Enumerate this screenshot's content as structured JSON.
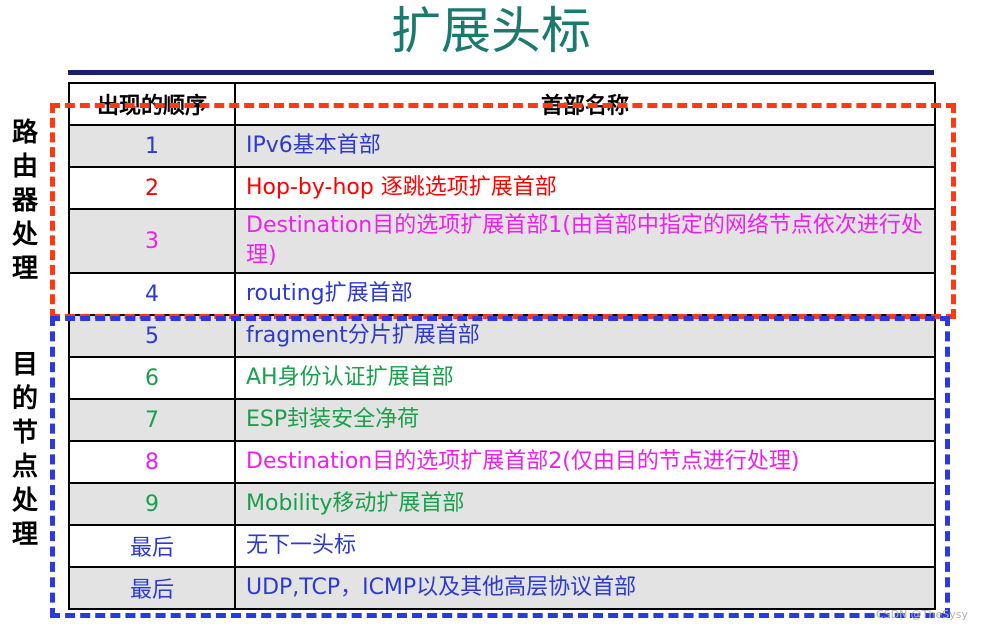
{
  "title": "扩展头标",
  "table": {
    "headers": [
      "出现的顺序",
      "首部名称"
    ],
    "rows": [
      {
        "order": "1",
        "name": "IPv6基本首部",
        "color": "#2c3ad0"
      },
      {
        "order": "2",
        "name": "Hop-by-hop 逐跳选项扩展首部",
        "color": "#ff0000"
      },
      {
        "order": "3",
        "name": "Destination目的选项扩展首部1(由首部中指定的网络节点依次进行处理)",
        "color": "#f01ef0"
      },
      {
        "order": "4",
        "name": "routing扩展首部",
        "color": "#2c3ad0"
      },
      {
        "order": "5",
        "name": "fragment分片扩展首部",
        "color": "#2c3ad0"
      },
      {
        "order": "6",
        "name": "AH身份认证扩展首部",
        "color": "#1aa04a"
      },
      {
        "order": "7",
        "name": "ESP封装安全净荷",
        "color": "#1aa04a"
      },
      {
        "order": "8",
        "name": "Destination目的选项扩展首部2(仅由目的节点进行处理)",
        "color": "#f01ef0"
      },
      {
        "order": "9",
        "name": "Mobility移动扩展首部",
        "color": "#1aa04a"
      },
      {
        "order": "最后",
        "name": "无下一头标",
        "color": "#2c3ad0"
      },
      {
        "order": "最后",
        "name": "UDP,TCP，ICMP以及其他高层协议首部",
        "color": "#2c3ad0"
      }
    ]
  },
  "side_labels": {
    "router": "路由器处理",
    "destination": "目的节点处理"
  },
  "colors": {
    "title": "#1a7a6e",
    "router_box": "#ff3a12",
    "destination_box": "#2a3ae0"
  },
  "watermark": "CSDN @TheSysy"
}
